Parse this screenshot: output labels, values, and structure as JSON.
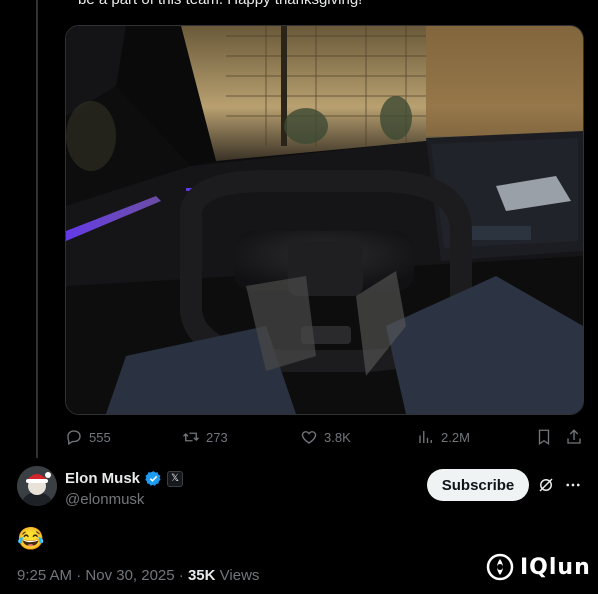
{
  "previous_tweet": {
    "text_fragment": "be a part of this team. Happy thanksgiving!"
  },
  "actions": {
    "replies": "555",
    "reposts": "273",
    "likes": "3.8K",
    "views": "2.2M"
  },
  "tweet": {
    "author_name": "Elon Musk",
    "author_handle": "@elonmusk",
    "affiliate_badge": "𝕏",
    "subscribe_label": "Subscribe",
    "body_emoji": "😂",
    "time": "9:25 AM",
    "date": "Nov 30, 2025",
    "separator": "·",
    "views_count": "35K",
    "views_label": "Views"
  },
  "watermark": {
    "text": "IQlun"
  },
  "colors": {
    "background": "#000000",
    "text_primary": "#e7e9ea",
    "text_secondary": "#71767b",
    "verified_blue": "#1d9bf0",
    "subscribe_bg": "#eff3f4",
    "ambient_purple": "#8a4dff"
  },
  "icons": [
    "reply-icon",
    "repost-icon",
    "like-icon",
    "views-icon",
    "bookmark-icon",
    "share-icon",
    "verified-icon",
    "grok-icon",
    "more-icon"
  ]
}
